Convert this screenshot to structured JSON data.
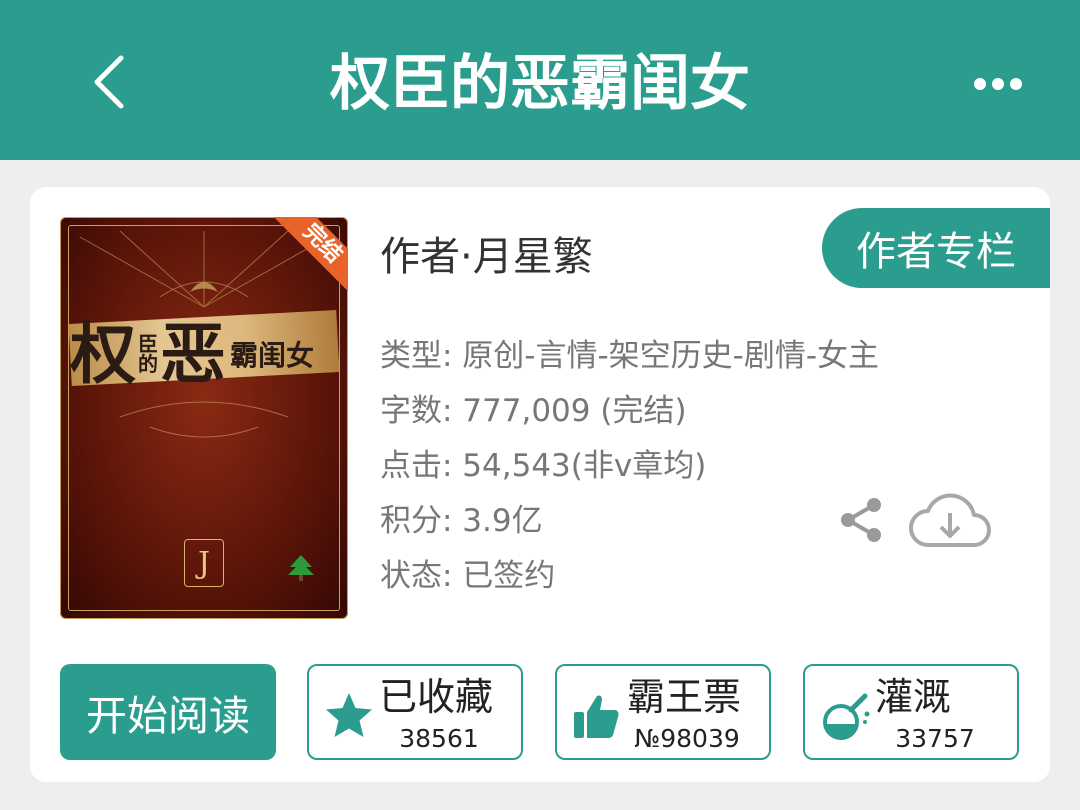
{
  "header": {
    "title": "权臣的恶霸闺女",
    "back_icon": "chevron-left-icon",
    "more_icon": "more-horizontal-icon",
    "color": "#2a9d8f"
  },
  "book": {
    "cover": {
      "ribbon": "完结",
      "title_big1": "权",
      "title_small1": "臣",
      "title_small2": "的",
      "title_big2": "恶",
      "title_rest": "霸闺女",
      "logo_letter": "J"
    },
    "author": "作者·月星繁",
    "author_column_label": "作者专栏",
    "meta": [
      "类型: 原创-言情-架空历史-剧情-女主",
      "字数: 777,009 (完结)",
      "点击: 54,543(非v章均)",
      "积分: 3.9亿",
      "状态: 已签约"
    ]
  },
  "actions": {
    "read_label": "开始阅读",
    "collect": {
      "label": "已收藏",
      "count": "38561",
      "icon": "star-icon"
    },
    "vote": {
      "label": "霸王票",
      "count": "№98039",
      "icon": "thumbs-up-icon"
    },
    "water": {
      "label": "灌溉",
      "count": "33757",
      "icon": "flask-icon"
    },
    "share_icon": "share-icon",
    "download_icon": "cloud-download-icon"
  },
  "colors": {
    "accent": "#2a9d8f",
    "ribbon": "#e8632a",
    "meta_text": "#777777"
  }
}
